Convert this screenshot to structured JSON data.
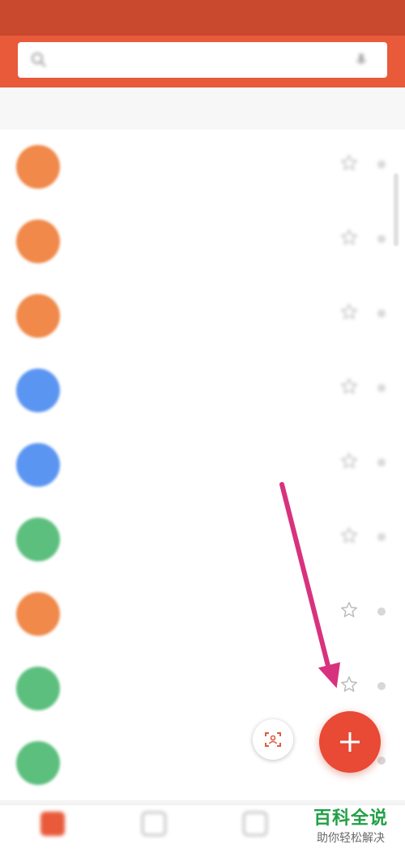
{
  "status_bar": {
    "left": "",
    "right": ""
  },
  "search": {
    "placeholder": ""
  },
  "section": {
    "label": ""
  },
  "contacts": [
    {
      "title": "",
      "sub": "",
      "avatar_color": "#f0894a",
      "star_state": "inactive"
    },
    {
      "title": "",
      "sub": "",
      "avatar_color": "#f0894a",
      "star_state": "inactive"
    },
    {
      "title": "",
      "sub": "",
      "avatar_color": "#f0894a",
      "star_state": "inactive"
    },
    {
      "title": "",
      "sub": "",
      "avatar_color": "#5b95f2",
      "star_state": "inactive"
    },
    {
      "title": "",
      "sub": "",
      "avatar_color": "#5b95f2",
      "star_state": "inactive"
    },
    {
      "title": "",
      "sub": "",
      "avatar_color": "#5cbf7e",
      "star_state": "inactive"
    },
    {
      "title": "",
      "sub": "",
      "avatar_color": "#f0894a",
      "star_state": "inactive"
    },
    {
      "title": "",
      "sub": "",
      "avatar_color": "#5cbf7e",
      "star_state": "inactive"
    },
    {
      "title": "",
      "sub": "",
      "avatar_color": "#5cbf7e",
      "star_state": "inactive"
    }
  ],
  "bottom_nav": [
    {
      "label": "",
      "icon": "contacts-icon",
      "active": true
    },
    {
      "label": "",
      "icon": "calls-icon",
      "active": false
    },
    {
      "label": "",
      "icon": "messages-icon",
      "active": false
    },
    {
      "label": "",
      "icon": "more-icon",
      "active": false
    }
  ],
  "watermark": {
    "title": "百科全说",
    "subtitle": "助你轻松解决"
  },
  "colors": {
    "header": "#e85a3a",
    "status_bar": "#c9492f",
    "fab": "#e84a35",
    "arrow": "#d8327e",
    "watermark_green": "#21a046"
  }
}
